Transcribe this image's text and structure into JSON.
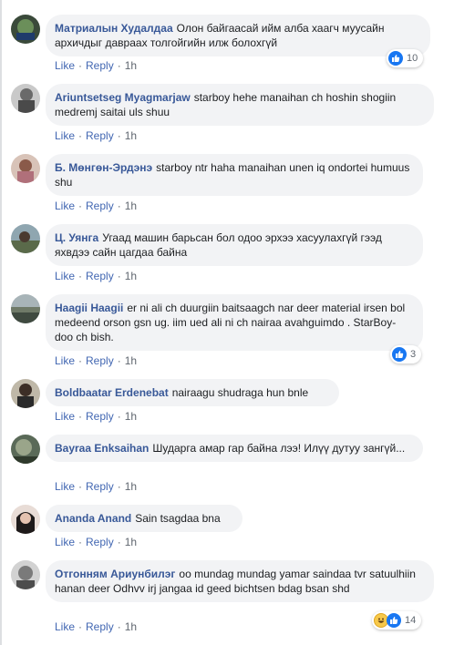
{
  "comments": [
    {
      "author": "Матриалын Худалдаа",
      "text": "Олон байгаасай ийм алба хаагч муусайн архичдыг давраах толгойгийн илж болохгүй",
      "like": "Like",
      "reply": "Reply",
      "time": "1h",
      "reactions": {
        "count": "10",
        "icons": [
          "like-icon"
        ]
      }
    },
    {
      "author": "Ariuntsetseg Myagmarjaw",
      "text": "starboy hehe manaihan ch hoshin shogiin medremj saitai uls shuu",
      "like": "Like",
      "reply": "Reply",
      "time": "1h"
    },
    {
      "author": "Б. Мөнгөн-Эрдэнэ",
      "text": "starboy ntr haha manaihan unen iq ondortei humuus shu",
      "like": "Like",
      "reply": "Reply",
      "time": "1h"
    },
    {
      "author": "Ц. Уянга",
      "text": "Угаад машин барьсан бол одоо эрхээ хасуулахгүй гээд яхвдээ сайн цагдаа байна",
      "like": "Like",
      "reply": "Reply",
      "time": "1h"
    },
    {
      "author": "Haagii Haagii",
      "text": "er ni ali ch duurgiin baitsaagch nar deer material irsen bol medeend orson gsn ug. iim ued ali ni ch nairaa avahguimdo . StarBoy-doo ch bish.",
      "like": "Like",
      "reply": "Reply",
      "time": "1h",
      "reactions": {
        "count": "3",
        "icons": [
          "like-icon"
        ]
      }
    },
    {
      "author": "Boldbaatar Erdenebat",
      "text": "nairaagu shudraga hun bnle",
      "like": "Like",
      "reply": "Reply",
      "time": "1h"
    },
    {
      "author": "Bayraa Enksaihan",
      "text": "Шударга амар гар байна лээ! Илүү дутуу зангүй...",
      "like": "Like",
      "reply": "Reply",
      "time": "1h"
    },
    {
      "author": "Ananda Anand",
      "text": "Sain tsagdaa bna",
      "like": "Like",
      "reply": "Reply",
      "time": "1h"
    },
    {
      "author": "Отгонням Ариунбилэг",
      "text": "oo mundag mundag yamar saindaa tvr satuulhiin hanan deer Odhvv irj jangaa id geed bichtsen bdag bsan shd",
      "like": "Like",
      "reply": "Reply",
      "time": "1h",
      "reactions": {
        "count": "14",
        "icons": [
          "haha-icon",
          "like-icon"
        ]
      }
    }
  ],
  "colors": {
    "author": "#385898",
    "link": "#4267b2",
    "bubble": "#f2f3f5",
    "like_blue": "#1877f2"
  }
}
